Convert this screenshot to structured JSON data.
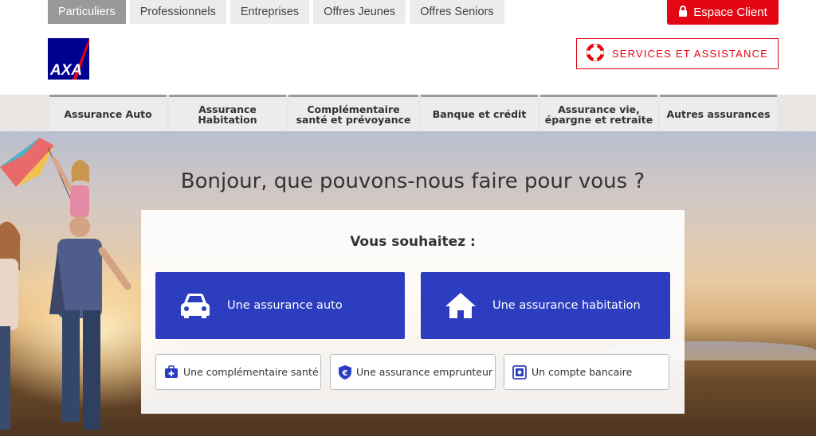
{
  "top_tabs": [
    {
      "label": "Particuliers",
      "active": true
    },
    {
      "label": "Professionnels",
      "active": false
    },
    {
      "label": "Entreprises",
      "active": false
    },
    {
      "label": "Offres Jeunes",
      "active": false
    },
    {
      "label": "Offres Seniors",
      "active": false
    }
  ],
  "header": {
    "espace_client": "Espace Client",
    "services": "SERVICES ET ASSISTANCE",
    "logo_text": "AXA"
  },
  "nav": [
    {
      "label": "Assurance Auto"
    },
    {
      "label": "Assurance\nHabitation"
    },
    {
      "label": "Complémentaire\nsanté et prévoyance"
    },
    {
      "label": "Banque et crédit"
    },
    {
      "label": "Assurance vie,\népargne et retraite"
    },
    {
      "label": "Autres assurances"
    }
  ],
  "hero": {
    "title": "Bonjour, que pouvons-nous faire pour vous ?",
    "subtitle": "Vous souhaitez :",
    "primary_actions": [
      {
        "label": "Une assurance auto",
        "icon": "car-icon"
      },
      {
        "label": "Une assurance habitation",
        "icon": "house-icon"
      }
    ],
    "secondary_actions": [
      {
        "label": "Une complémentaire santé",
        "icon": "medical-kit-icon"
      },
      {
        "label": "Une assurance emprunteur",
        "icon": "euro-shield-icon"
      },
      {
        "label": "Un compte bancaire",
        "icon": "safe-icon"
      }
    ]
  },
  "colors": {
    "brand_red": "#e30613",
    "axa_blue": "#00008f",
    "action_blue": "#2c3ebf",
    "icon_blue": "#2c3ebf"
  }
}
